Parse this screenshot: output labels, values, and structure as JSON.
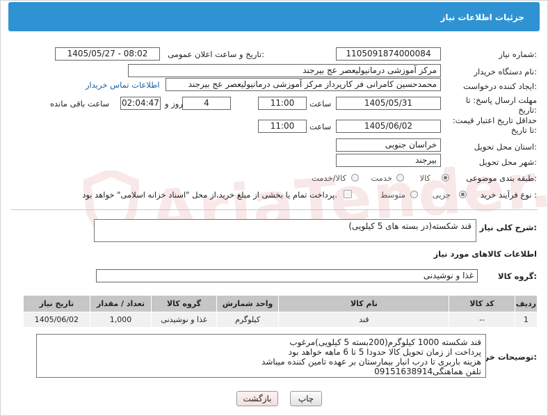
{
  "header": {
    "title": "جزئیات اطلاعات نیاز"
  },
  "fields": {
    "need_number_label": "شماره نیاز:",
    "need_number": "1105091874000084",
    "announce_label": "تاریخ و ساعت اعلان عمومی:",
    "announce_value": "1405/05/27 - 08:02",
    "buyer_org_label": "نام دستگاه خریدار:",
    "buyer_org": "مرکز آموزشی درمانیولیعصر  عج  بیرجند",
    "requester_label": "ایجاد کننده درخواست:",
    "requester": "محمدحسین کامرانی فر کارپرداز مرکز آموزشی درمانیولیعصر  عج  بیرجند",
    "contact_link": "اطلاعات تماس خریدار",
    "deadline_label": "مهلت ارسال پاسخ: تا تاریخ:",
    "deadline_date": "1405/05/31",
    "time_label": "ساعت",
    "deadline_time": "11:00",
    "days_value": "4",
    "days_label": "روز و",
    "remaining_value": "02:04:47",
    "remaining_label": "ساعت باقی مانده",
    "validity_label": "حداقل تاریخ اعتبار قیمت: تا تاریخ:",
    "validity_date": "1405/06/02",
    "validity_time": "11:00",
    "province_label": "استان محل تحویل:",
    "province": "خراسان جنوبی",
    "city_label": "شهر محل تحویل:",
    "city": "بیرجند",
    "category_label": "طبقه بندی موضوعی:",
    "category_options": [
      "کالا",
      "خدمت",
      "کالا/خدمت"
    ],
    "process_label": "نوع فرآیند خرید :",
    "process_options": [
      "جزیی",
      "متوسط"
    ],
    "payment_note": "پرداخت تمام یا بخشی از مبلغ خرید،از محل \"اسناد خزانه اسلامی\" خواهد بود."
  },
  "summary": {
    "label": "شرح کلی نیاز:",
    "text": "قند شکسته(در بسته های 5 کیلویی)"
  },
  "goods": {
    "section_title": "اطلاعات کالاهای مورد نیاز",
    "group_label": "گروه کالا:",
    "group_value": "غذا و نوشیدنی",
    "columns": [
      "ردیف",
      "کد کالا",
      "نام کالا",
      "واحد شمارش",
      "گروه کالا",
      "تعداد / مقدار",
      "تاریخ نیاز"
    ],
    "rows": [
      [
        "1",
        "--",
        "قند",
        "کیلوگرم",
        "غذا و نوشیدنی",
        "1,000",
        "1405/06/02"
      ]
    ]
  },
  "buyer_notes": {
    "label": "توضیحات خریدار:",
    "lines": [
      "قند شکسته 1000 کیلوگرم(200بسته 5 کیلویی)مرغوب",
      "پرداخت از زمان تحویل کالا حدودا  5 تا 6 ماهه خواهد بود",
      "هزینه باربری تا درب انبار بیمارستان بر عهده تامین کننده میباشد",
      "تلفن هماهنگی09151638914"
    ]
  },
  "buttons": {
    "print": "چاپ",
    "back": "بازگشت"
  },
  "watermark": "AriaTender.neT"
}
